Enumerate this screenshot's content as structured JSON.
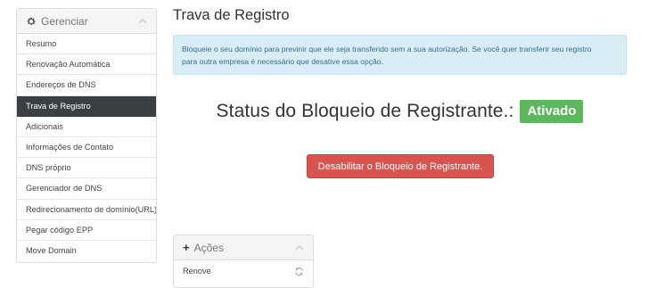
{
  "sidebar": {
    "title": "Gerenciar",
    "items": [
      {
        "label": "Resumo"
      },
      {
        "label": "Renovação Automática"
      },
      {
        "label": "Endereços de DNS"
      },
      {
        "label": "Trava de Registro"
      },
      {
        "label": "Adicionais"
      },
      {
        "label": "Informações de Contato"
      },
      {
        "label": "DNS próprio"
      },
      {
        "label": "Gerenciador de DNS"
      },
      {
        "label": "Redirecionamento de domínio(URL)"
      },
      {
        "label": "Pegar código EPP"
      },
      {
        "label": "Move Domain"
      }
    ],
    "active_item": "Trava de Registro"
  },
  "main": {
    "title": "Trava de Registro",
    "alert": {
      "line1": "Bloqueie o seu domínio para previnir que ele seja transferido sem a sua autorização. Se você quer transferir seu registro",
      "line2": "para outra empresa é necessário que desative essa opção."
    },
    "status_label": "Status do Bloqueio de Registrante.:",
    "status_value": "Ativado",
    "disable_button_label": "Desabilitar o Bloqueio de Registrante."
  },
  "actions": {
    "title": "Ações",
    "items": [
      {
        "label": "Renove",
        "icon": "refresh-icon"
      }
    ]
  },
  "colors": {
    "active_bg": "#3a3f44",
    "alert_bg": "#d9edf7",
    "alert_text": "#31708f",
    "success": "#5cb85c",
    "danger": "#d9534f"
  }
}
